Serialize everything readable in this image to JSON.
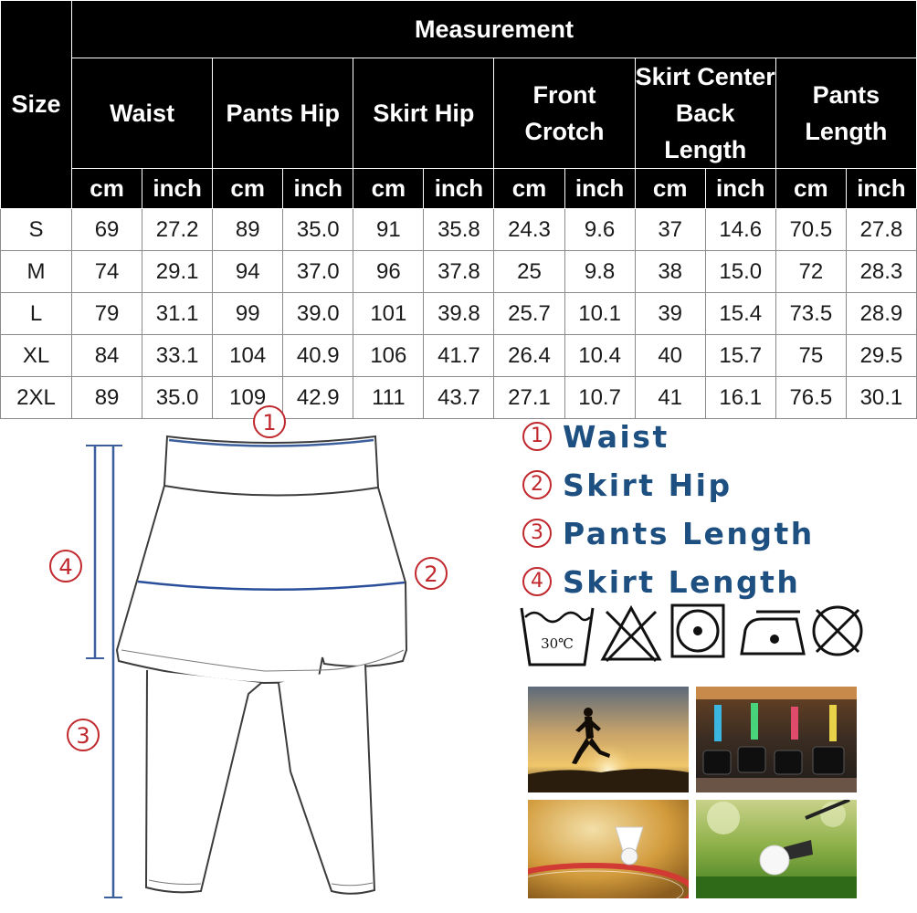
{
  "table": {
    "size_header": "Size",
    "measurement_header": "Measurement",
    "columns": [
      "Waist",
      "Pants Hip",
      "Skirt Hip",
      "Front Crotch",
      "Skirt Center Back Length",
      "Pants Length"
    ],
    "skirt_center_line1": "Skirt Center",
    "skirt_center_line2": "Back Length",
    "units": [
      "cm",
      "inch"
    ],
    "rows": [
      {
        "size": "S",
        "values": [
          "69",
          "27.2",
          "89",
          "35.0",
          "91",
          "35.8",
          "24.3",
          "9.6",
          "37",
          "14.6",
          "70.5",
          "27.8"
        ]
      },
      {
        "size": "M",
        "values": [
          "74",
          "29.1",
          "94",
          "37.0",
          "96",
          "37.8",
          "25",
          "9.8",
          "38",
          "15.0",
          "72",
          "28.3"
        ]
      },
      {
        "size": "L",
        "values": [
          "79",
          "31.1",
          "99",
          "39.0",
          "101",
          "39.8",
          "25.7",
          "10.1",
          "39",
          "15.4",
          "73.5",
          "28.9"
        ]
      },
      {
        "size": "XL",
        "values": [
          "84",
          "33.1",
          "104",
          "40.9",
          "106",
          "41.7",
          "26.4",
          "10.4",
          "40",
          "15.7",
          "75",
          "29.5"
        ]
      },
      {
        "size": "2XL",
        "values": [
          "89",
          "35.0",
          "109",
          "42.9",
          "111",
          "43.7",
          "27.1",
          "10.7",
          "41",
          "16.1",
          "76.5",
          "30.1"
        ]
      }
    ]
  },
  "diagram": {
    "markers": [
      "①",
      "②",
      "③",
      "④"
    ]
  },
  "legend": [
    {
      "num": "1",
      "label": "Waist"
    },
    {
      "num": "2",
      "label": "Skirt Hip"
    },
    {
      "num": "3",
      "label": "Pants Length"
    },
    {
      "num": "4",
      "label": "Skirt Length"
    }
  ],
  "care_icons": {
    "wash_temp": "30℃",
    "icons": [
      "wash-30-icon",
      "no-bleach-icon",
      "tumble-dry-icon",
      "iron-low-icon",
      "no-dry-clean-icon"
    ]
  },
  "photos": [
    "running-sunset-photo",
    "gym-equipment-photo",
    "badminton-photo",
    "golf-photo"
  ],
  "colors": {
    "header_bg": "#000000",
    "marker_red": "#c0282d",
    "legend_blue": "#1d4f80",
    "measure_blue": "#3a5f9c"
  }
}
